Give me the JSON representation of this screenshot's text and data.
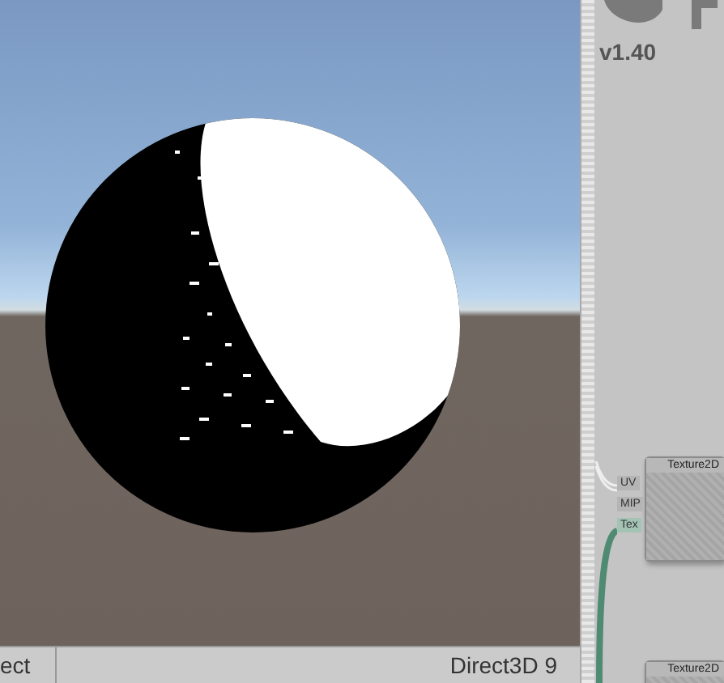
{
  "preview": {
    "status_left": "ect",
    "renderer": "Direct3D 9"
  },
  "side_panel": {
    "version": "v1.40",
    "nodes": [
      {
        "title": "Texture2D",
        "ports": [
          {
            "label": "UV",
            "highlighted": false
          },
          {
            "label": "MIP",
            "highlighted": false
          },
          {
            "label": "Tex",
            "highlighted": true
          }
        ]
      },
      {
        "title": "Texture2D"
      }
    ]
  }
}
